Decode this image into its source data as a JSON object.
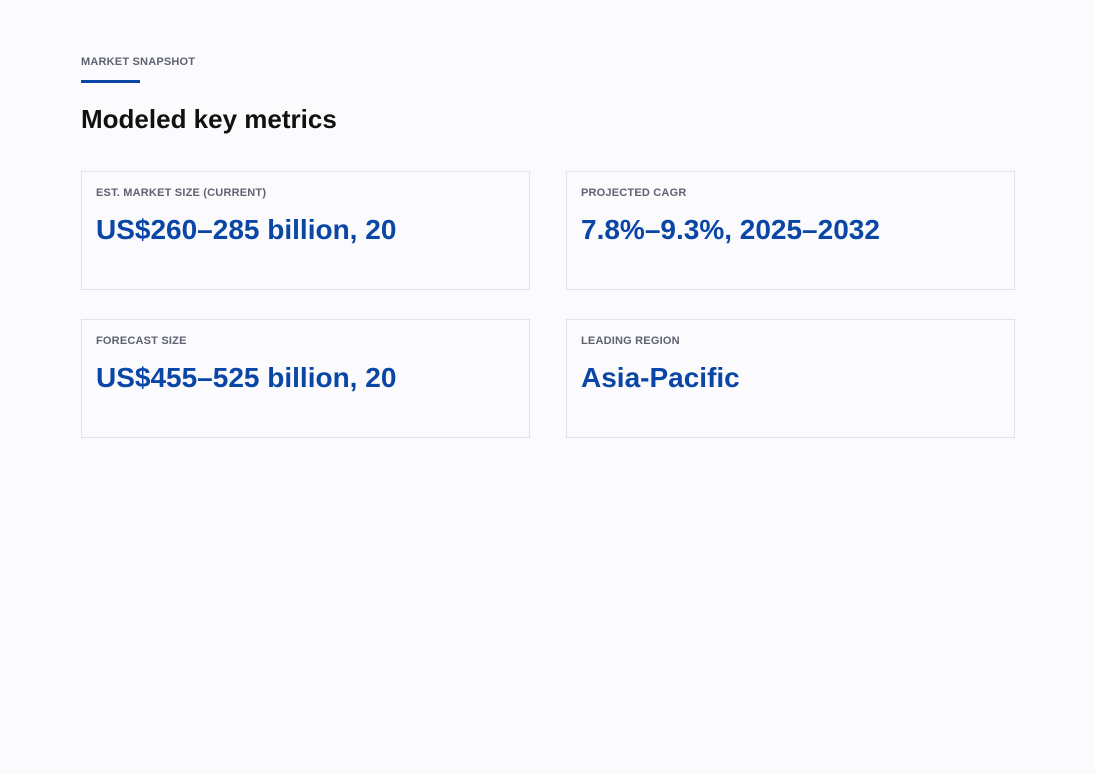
{
  "section": {
    "eyebrow": "MARKET SNAPSHOT",
    "title": "Modeled key metrics"
  },
  "metrics": [
    {
      "label": "EST. MARKET SIZE (CURRENT)",
      "value": "US$260–285 billion, 20"
    },
    {
      "label": "PROJECTED CAGR",
      "value": "7.8%–9.3%, 2025–2032"
    },
    {
      "label": "FORECAST SIZE",
      "value": "US$455–525 billion, 20"
    },
    {
      "label": "LEADING REGION",
      "value": "Asia-Pacific"
    }
  ],
  "colors": {
    "accent": "#0a46a5",
    "background": "#fbfbfe",
    "muted_text": "#5f6270",
    "card_border": "#e2e2e8"
  }
}
